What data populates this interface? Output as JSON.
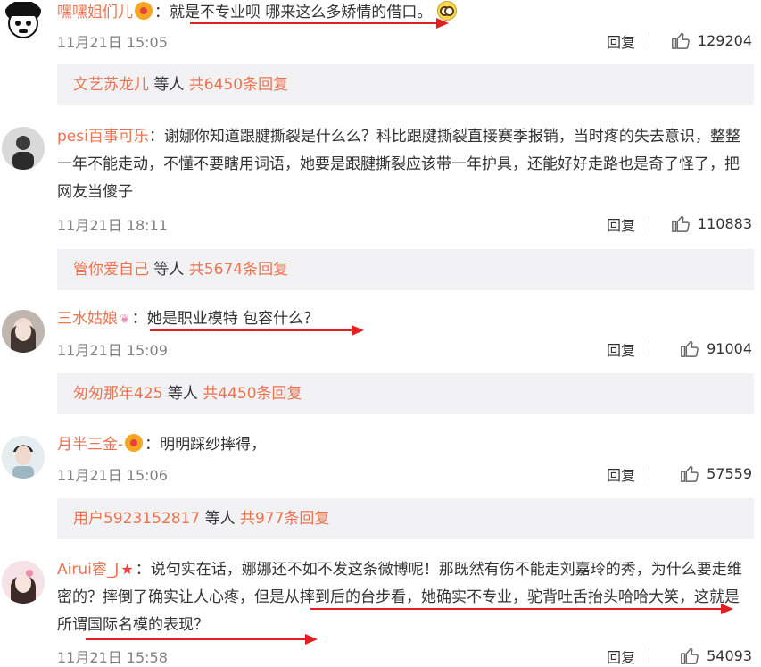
{
  "comments": [
    {
      "user": "嘿嘿姐们儿",
      "colon": "：",
      "text": "就是不专业呗 哪来这么多矫情的借口。",
      "time": "11月21日 15:05",
      "reply_label": "回复",
      "likes": "129204",
      "replies": {
        "user": "文艺苏龙儿",
        "mid": " 等人 ",
        "count": "共6450条回复"
      }
    },
    {
      "user": "pesi百事可乐",
      "colon": "：",
      "text": "谢娜你知道跟腱撕裂是什么么？科比跟腱撕裂直接赛季报销，当时疼的失去意识，整整一年不能走动，不懂不要瞎用词语，她要是跟腱撕裂应该带一年护具，还能好好走路也是奇了怪了，把网友当傻子",
      "time": "11月21日 18:11",
      "reply_label": "回复",
      "likes": "110883",
      "replies": {
        "user": "管你爱自己",
        "mid": " 等人 ",
        "count": "共5674条回复"
      }
    },
    {
      "user": "三水姑娘",
      "colon": "：",
      "text": "她是职业模特   包容什么？",
      "time": "11月21日 15:09",
      "reply_label": "回复",
      "likes": "91004",
      "replies": {
        "user": "匆匆那年425",
        "mid": " 等人 ",
        "count": "共4450条回复"
      }
    },
    {
      "user": "月半三金-",
      "colon": "：",
      "text": "明明踩纱摔得，",
      "time": "11月21日 15:06",
      "reply_label": "回复",
      "likes": "57559",
      "replies": {
        "user": "用户5923152817",
        "mid": " 等人 ",
        "count": "共977条回复"
      }
    },
    {
      "user": "Airui睿_J",
      "colon": "：",
      "text": "说句实在话，娜娜还不如不发这条微博呢！那既然有伤不能走刘嘉玲的秀，为什么要走维密的？摔倒了确实让人心疼，但是从摔到后的台步看，她确实不专业，驼背吐舌抬头哈哈大笑，这就是所谓国际名模的表现？",
      "time": "11月21日 15:58",
      "reply_label": "回复",
      "likes": "54093"
    }
  ],
  "colors": {
    "username": "#eb7350",
    "annotation_arrow": "#e02020",
    "reply_bg": "#f2f2f5"
  }
}
